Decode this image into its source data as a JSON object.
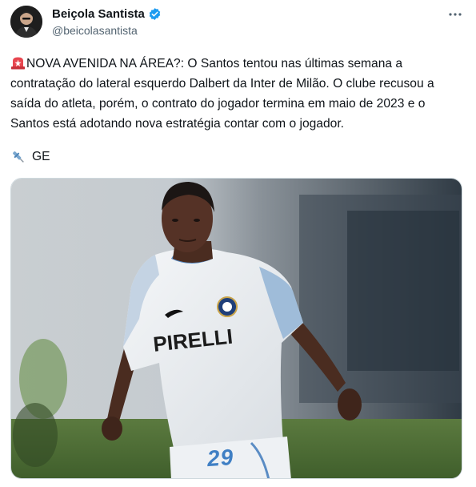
{
  "author": {
    "display_name": "Beiçola Santista",
    "handle": "@beicolasantista",
    "verified": true
  },
  "tweet": {
    "text": "NOVA AVENIDA NA ÁREA?: O Santos tentou nas últimas semana a contratação do lateral esquerdo Dalbert da Inter de Milão. O clube recusou a saída do atleta, porém, o contrato do jogador termina em maio de 2023 e o Santos está adotando nova estratégia contar com o jogador.",
    "leading_emoji": "rotating-light-icon",
    "source_emoji": "pin-icon",
    "source_label": "GE"
  },
  "media": {
    "kind": "photo",
    "sponsor_text": "PIRELLI",
    "kit_number": "29"
  },
  "colors": {
    "verified_blue": "#1d9bf0",
    "text": "#0f1419",
    "secondary_text": "#536471",
    "kit_blue": "#3f7fc4"
  }
}
